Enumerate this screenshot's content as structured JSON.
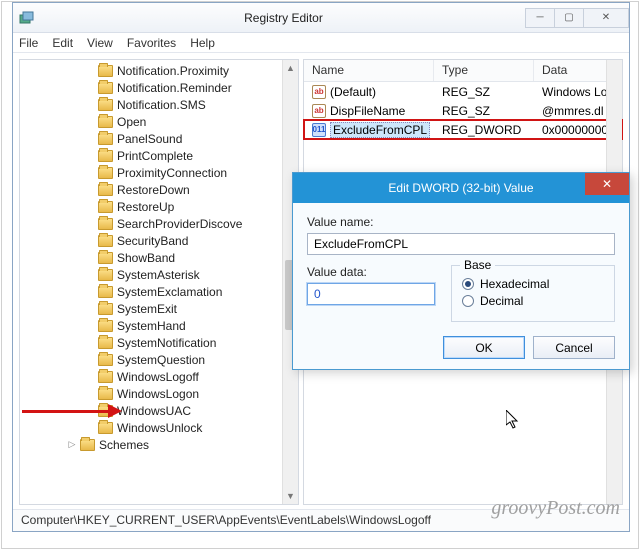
{
  "window": {
    "title": "Registry Editor",
    "menu": [
      "File",
      "Edit",
      "View",
      "Favorites",
      "Help"
    ]
  },
  "tree": {
    "items": [
      "Notification.Proximity",
      "Notification.Reminder",
      "Notification.SMS",
      "Open",
      "PanelSound",
      "PrintComplete",
      "ProximityConnection",
      "RestoreDown",
      "RestoreUp",
      "SearchProviderDiscove",
      "SecurityBand",
      "ShowBand",
      "SystemAsterisk",
      "SystemExclamation",
      "SystemExit",
      "SystemHand",
      "SystemNotification",
      "SystemQuestion",
      "WindowsLogoff",
      "WindowsLogon",
      "WindowsUAC",
      "WindowsUnlock"
    ],
    "parent": "Schemes",
    "highlighted_index": 18
  },
  "list": {
    "columns": {
      "name": "Name",
      "type": "Type",
      "data": "Data"
    },
    "rows": [
      {
        "icon": "sz",
        "name": "(Default)",
        "type": "REG_SZ",
        "data": "Windows Lo"
      },
      {
        "icon": "sz",
        "name": "DispFileName",
        "type": "REG_SZ",
        "data": "@mmres.dl"
      },
      {
        "icon": "dw",
        "name": "ExcludeFromCPL",
        "type": "REG_DWORD",
        "data": "0x00000000",
        "selected": true
      }
    ]
  },
  "statusbar": "Computer\\HKEY_CURRENT_USER\\AppEvents\\EventLabels\\WindowsLogoff",
  "dialog": {
    "title": "Edit DWORD (32-bit) Value",
    "value_name_label": "Value name:",
    "value_name": "ExcludeFromCPL",
    "value_data_label": "Value data:",
    "value_data": "0",
    "base_label": "Base",
    "radio_hex": "Hexadecimal",
    "radio_dec": "Decimal",
    "radio_selected": "hex",
    "ok": "OK",
    "cancel": "Cancel"
  },
  "watermark": "groovyPost.com"
}
